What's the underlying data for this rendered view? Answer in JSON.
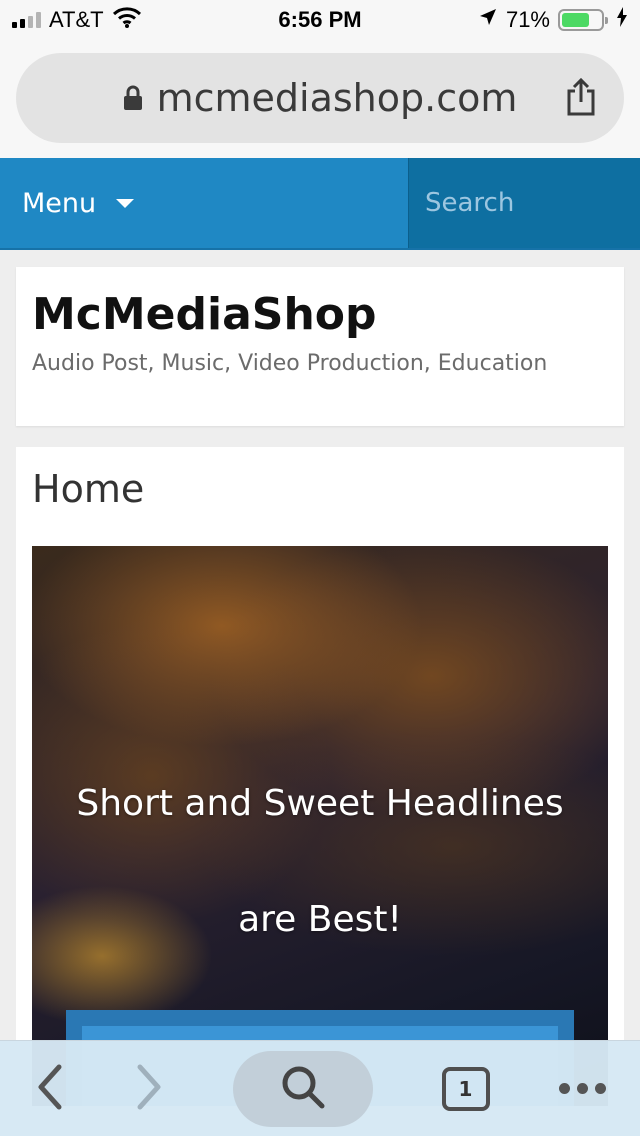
{
  "status_bar": {
    "carrier": "AT&T",
    "time": "6:56 PM",
    "battery_percent_label": "71%",
    "battery_level": 0.71,
    "signal_bars_active": 2,
    "icons": [
      "signal-icon",
      "wifi-icon",
      "location-arrow-icon",
      "battery-icon",
      "charging-bolt-icon"
    ]
  },
  "browser": {
    "url": "mcmediashop.com",
    "tab_count": "1",
    "icons": [
      "lock-icon",
      "share-icon",
      "back-icon",
      "forward-icon",
      "search-icon",
      "tabs-icon",
      "more-icon"
    ]
  },
  "nav": {
    "menu_label": "Menu",
    "search_placeholder": "Search",
    "colors": {
      "bar": "#1f88c4",
      "search_bg": "#0e6fa1"
    }
  },
  "site": {
    "title": "McMediaShop",
    "description": "Audio Post, Music, Video Production, Education"
  },
  "content": {
    "page_title": "Home",
    "hero": {
      "headline_line1": "Short and Sweet Headlines",
      "headline_line2": "are Best!"
    }
  }
}
